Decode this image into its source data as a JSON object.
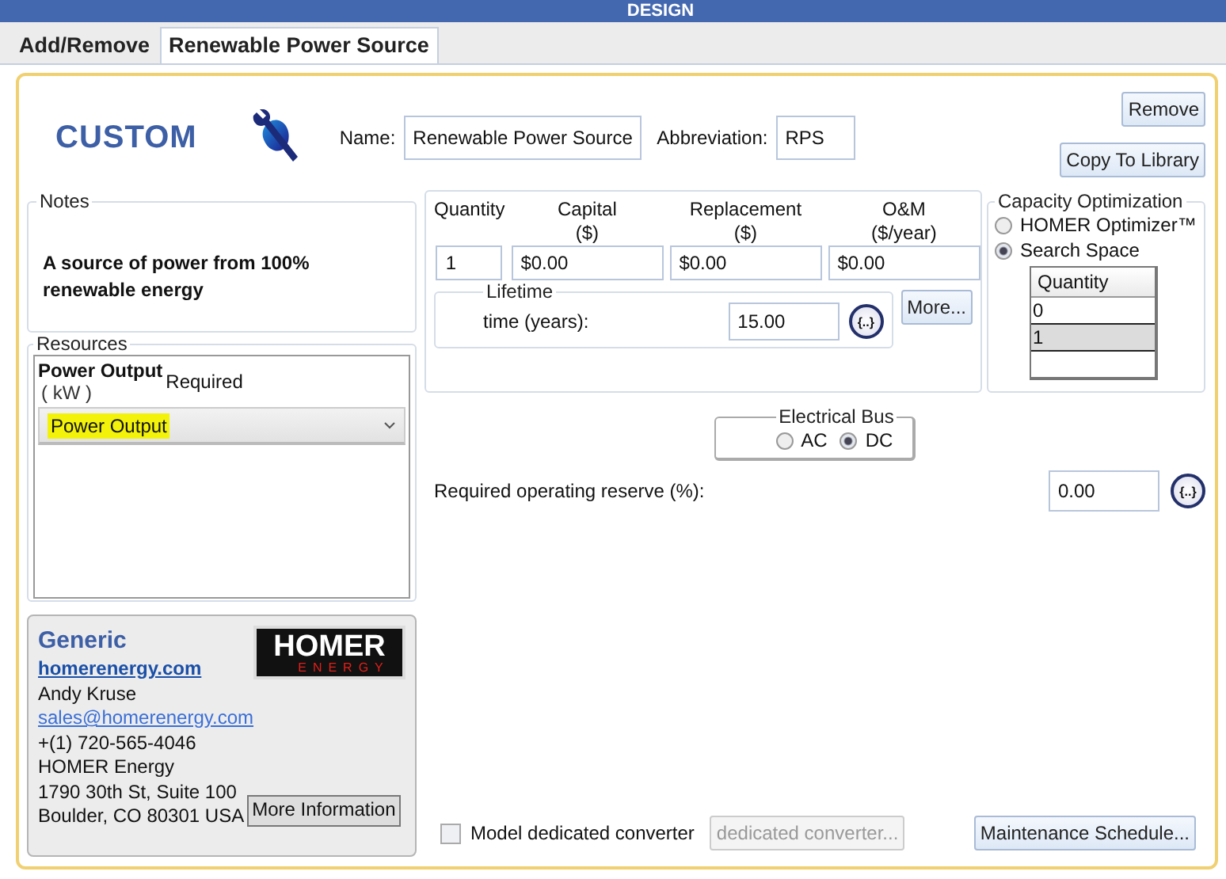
{
  "header": {
    "title": "DESIGN"
  },
  "tabs": [
    {
      "label": "Add/Remove",
      "selected": false
    },
    {
      "label": "Renewable Power Source",
      "selected": true
    }
  ],
  "component": {
    "logo_text": "CUSTOM",
    "name_label": "Name:",
    "name_value": "Renewable Power Source",
    "abbreviation_label": "Abbreviation:",
    "abbreviation_value": "RPS"
  },
  "actions": [
    "Remove",
    "Copy To Library"
  ],
  "notes": {
    "legend": "Notes",
    "text": "A source of power from 100% renewable energy"
  },
  "resources": {
    "legend": "Resources",
    "column_label": "Power Output",
    "unit": "( kW )",
    "required_label": "Required",
    "dropdown_value": "Power Output",
    "highlighted": true
  },
  "costs": {
    "columns": [
      {
        "label": "Quantity",
        "value": "1"
      },
      {
        "label": "Capital",
        "unit": "($)",
        "value": "$0.00"
      },
      {
        "label": "Replacement",
        "unit": "($)",
        "value": "$0.00"
      },
      {
        "label": "O&M",
        "unit": "($/year)",
        "value": "$0.00"
      }
    ],
    "lifetime": {
      "legend": "Lifetime",
      "label": "time (years):",
      "value": "15.00",
      "sensitivity": "{..}"
    },
    "more_button": "More..."
  },
  "capacity_optimization": {
    "legend": "Capacity Optimization",
    "options": [
      {
        "label": "HOMER Optimizer™",
        "selected": false
      },
      {
        "label": "Search Space",
        "selected": true
      }
    ],
    "table_header": "Quantity",
    "rows": [
      {
        "value": "0",
        "selected": false
      },
      {
        "value": "1",
        "selected": true
      }
    ]
  },
  "electrical_bus": {
    "legend": "Electrical Bus",
    "options": [
      {
        "label": "AC",
        "selected": false
      },
      {
        "label": "DC",
        "selected": true
      }
    ]
  },
  "reserve": {
    "label": "Required operating reserve (%):",
    "value": "0.00",
    "sensitivity": "{..}"
  },
  "vendor": {
    "name": "Generic",
    "website": "homerenergy.com",
    "contact": "Andy Kruse",
    "email": "sales@homerenergy.com",
    "phone": "+(1) 720-565-4046",
    "company": "HOMER Energy",
    "address": [
      "1790 30th St, Suite 100",
      "Boulder, CO 80301 USA"
    ],
    "logo_text": "HOMER",
    "logo_subtext": "ENERGY",
    "more_button": "More Information"
  },
  "converter": {
    "label": "Model dedicated converter",
    "checked": false,
    "button": "dedicated converter...",
    "button_disabled": true
  },
  "maintenance_button": "Maintenance Schedule..."
}
